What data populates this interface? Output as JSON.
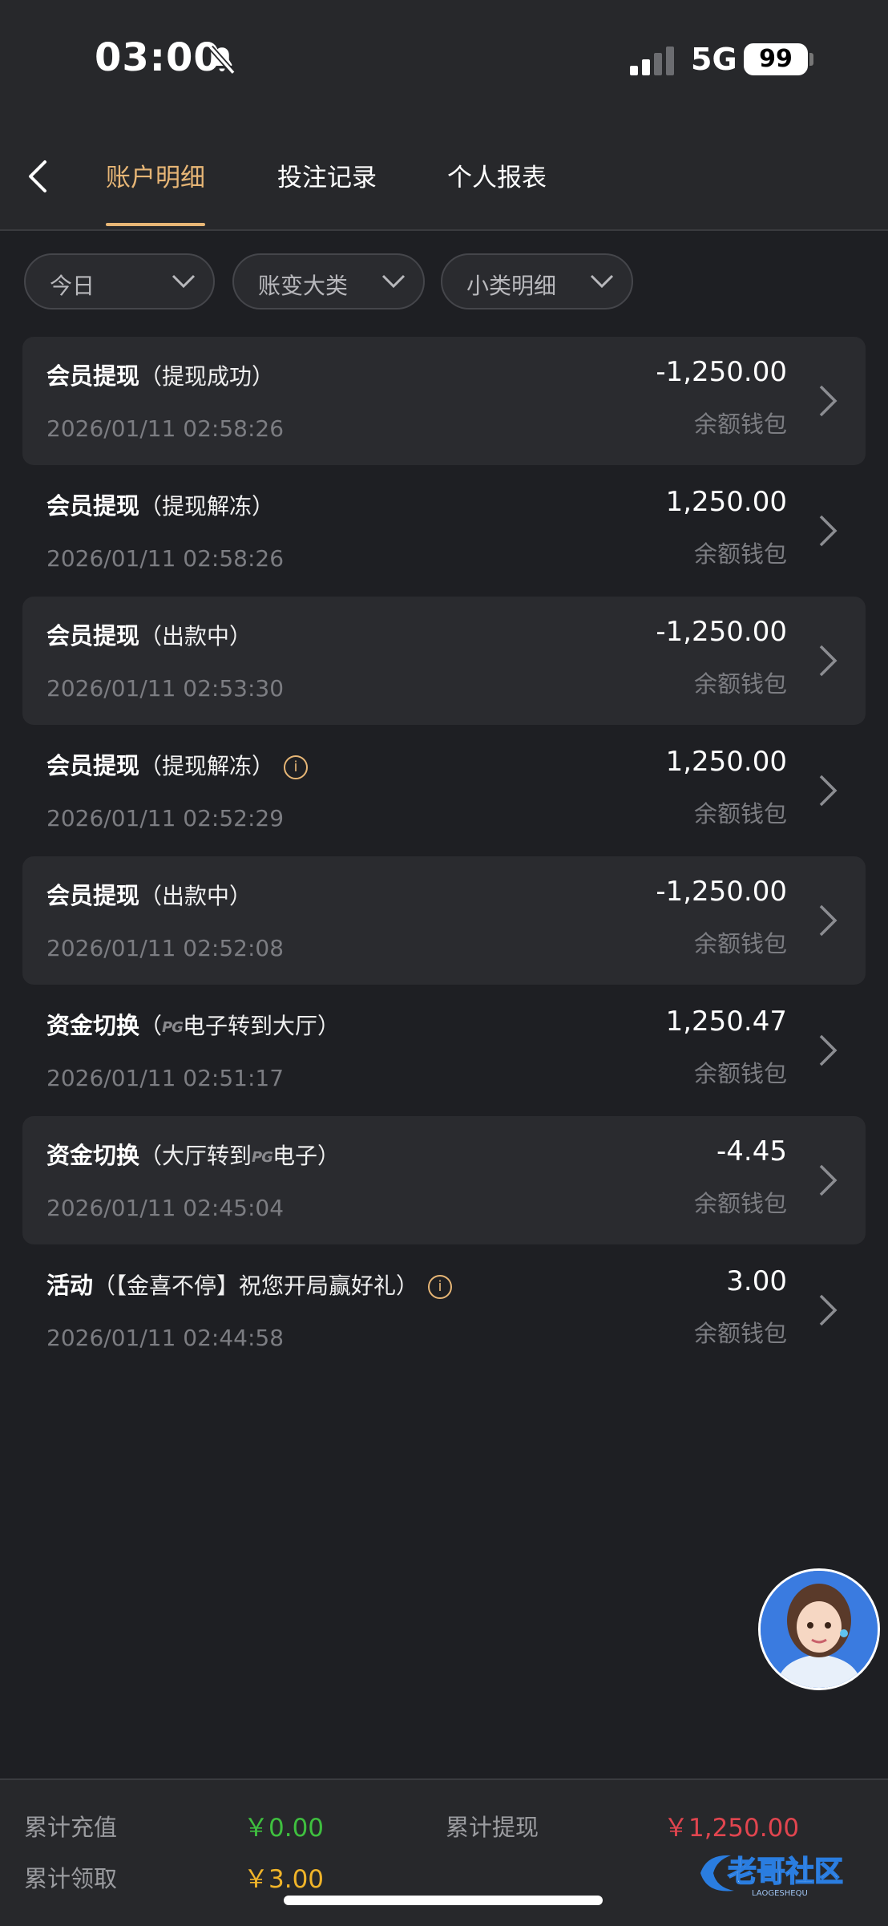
{
  "status_bar": {
    "time": "03:00",
    "network": "5G",
    "battery": "99"
  },
  "nav": {
    "tabs": [
      {
        "label": "账户明细"
      },
      {
        "label": "投注记录"
      },
      {
        "label": "个人报表"
      }
    ]
  },
  "filters": [
    {
      "label": "今日"
    },
    {
      "label": "账变大类"
    },
    {
      "label": "小类明细"
    }
  ],
  "transactions": [
    {
      "title": "会员提现",
      "detail": "（提现成功）",
      "date": "2026/01/11 02:58:26",
      "amount": "-1,250.00",
      "wallet": "余额钱包"
    },
    {
      "title": "会员提现",
      "detail": "（提现解冻）",
      "date": "2026/01/11 02:58:26",
      "amount": "1,250.00",
      "wallet": "余额钱包"
    },
    {
      "title": "会员提现",
      "detail": "（出款中）",
      "date": "2026/01/11 02:53:30",
      "amount": "-1,250.00",
      "wallet": "余额钱包"
    },
    {
      "title": "会员提现",
      "detail": "（提现解冻）",
      "date": "2026/01/11 02:52:29",
      "amount": "1,250.00",
      "wallet": "余额钱包"
    },
    {
      "title": "会员提现",
      "detail": "（出款中）",
      "date": "2026/01/11 02:52:08",
      "amount": "-1,250.00",
      "wallet": "余额钱包"
    },
    {
      "title": "资金切换",
      "detail_pre": "（",
      "detail_logo": "PG",
      "detail_post": "电子转到大厅）",
      "date": "2026/01/11 02:51:17",
      "amount": "1,250.47",
      "wallet": "余额钱包"
    },
    {
      "title": "资金切换",
      "detail_pre": "（大厅转到",
      "detail_logo": "PG",
      "detail_post": "电子）",
      "date": "2026/01/11 02:45:04",
      "amount": "-4.45",
      "wallet": "余额钱包"
    },
    {
      "title": "活动",
      "detail": "（【金喜不停】祝您开局赢好礼）",
      "date": "2026/01/11 02:44:58",
      "amount": "3.00",
      "wallet": "余额钱包"
    }
  ],
  "footer": {
    "total_deposit_label": "累计充值",
    "total_deposit_value": "￥0.00",
    "total_withdraw_label": "累计提现",
    "total_withdraw_value": "￥1,250.00",
    "total_claim_label": "累计领取",
    "total_claim_value": "￥3.00",
    "watermark_text": "老哥社区",
    "watermark_sub": "LAOGESHEQU"
  },
  "colors": {
    "accent": "#e7b676",
    "green": "#3fbf3f",
    "red": "#e0454f",
    "gold": "#f0b429"
  }
}
